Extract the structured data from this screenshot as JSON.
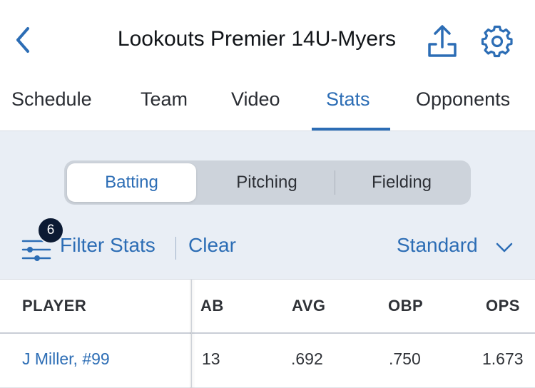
{
  "header": {
    "title": "Lookouts Premier 14U-Myers",
    "back_icon": "chevron-left-icon",
    "share_icon": "share-icon",
    "settings_icon": "gear-icon",
    "accent_color": "#2c6db5"
  },
  "tabs": [
    {
      "label": "Schedule",
      "active": false
    },
    {
      "label": "Team",
      "active": false
    },
    {
      "label": "Video",
      "active": false
    },
    {
      "label": "Stats",
      "active": true
    },
    {
      "label": "Opponents",
      "active": false
    }
  ],
  "segments": [
    {
      "label": "Batting",
      "active": true
    },
    {
      "label": "Pitching",
      "active": false
    },
    {
      "label": "Fielding",
      "active": false
    }
  ],
  "filter": {
    "badge_count": "6",
    "label": "Filter Stats",
    "clear_label": "Clear",
    "view_selected": "Standard"
  },
  "table": {
    "columns": [
      "PLAYER",
      "AB",
      "AVG",
      "OBP",
      "OPS"
    ],
    "rows": [
      {
        "player": "J Miller, #99",
        "ab": "13",
        "avg": ".692",
        "obp": ".750",
        "ops": "1.673"
      }
    ]
  }
}
